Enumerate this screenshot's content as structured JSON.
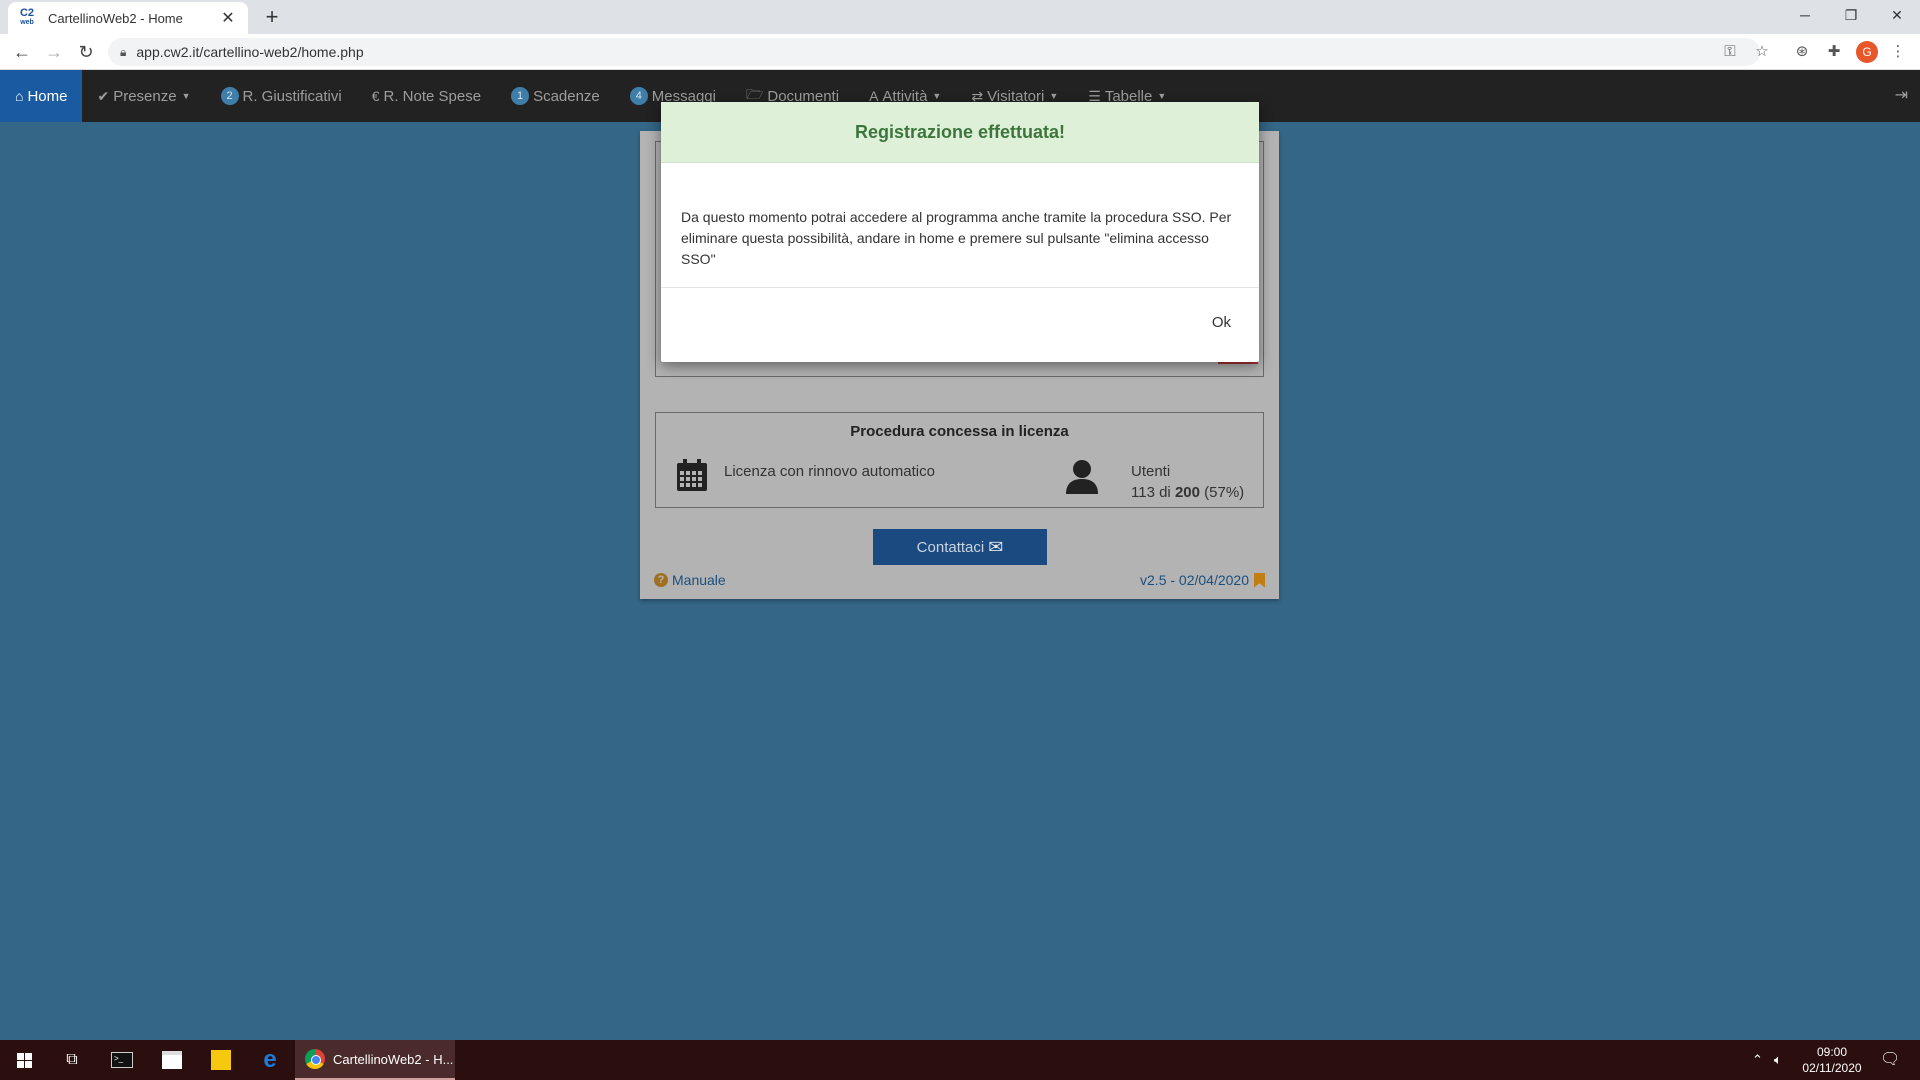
{
  "browser": {
    "tab_title": "CartellinoWeb2 - Home",
    "favicon_top": "C2",
    "favicon_bottom": "web",
    "url": "app.cw2.it/cartellino-web2/home.php",
    "avatar_letter": "G"
  },
  "navbar": {
    "items": [
      {
        "label": "Home",
        "icon": "home-icon"
      },
      {
        "label": "Presenze",
        "icon": "check-icon"
      },
      {
        "label": "R. Giustificativi",
        "badge": "2"
      },
      {
        "label": "R. Note Spese",
        "icon": "euro-icon"
      },
      {
        "label": "Scadenze",
        "badge": "1"
      },
      {
        "label": "Messaggi",
        "badge": "4"
      },
      {
        "label": "Documenti",
        "icon": "folder-icon"
      },
      {
        "label": "Attività",
        "icon": "font-icon"
      },
      {
        "label": "Visitatori",
        "icon": "transfer-icon"
      },
      {
        "label": "Tabelle",
        "icon": "list-icon"
      }
    ]
  },
  "license": {
    "title": "Procedura concessa in licenza",
    "type_text": "Licenza con rinnovo automatico",
    "users_label": "Utenti",
    "users_used": "113",
    "users_sep": "di",
    "users_total": "200",
    "users_pct": "(57%)",
    "users_fraction": 0.57
  },
  "contact_label": "Contattaci",
  "manual_label": "Manuale",
  "version_label": "v2.5 - 02/04/2020",
  "modal": {
    "title": "Registrazione effettuata!",
    "body": "Da questo momento potrai accedere al programma anche tramite la procedura SSO. Per eliminare questa possibilità, andare in home e premere sul pulsante \"elimina accesso SSO\"",
    "ok_label": "Ok"
  },
  "taskbar": {
    "active_task": "CartellinoWeb2 - H...",
    "time": "09:00",
    "date": "02/11/2020"
  },
  "colors": {
    "backdrop": "#346687",
    "navbar": "#222222",
    "nav_active": "#1a5aa0",
    "modal_header": "#dff0d8",
    "modal_title": "#3c763d",
    "contact_button": "#1a4a80"
  }
}
